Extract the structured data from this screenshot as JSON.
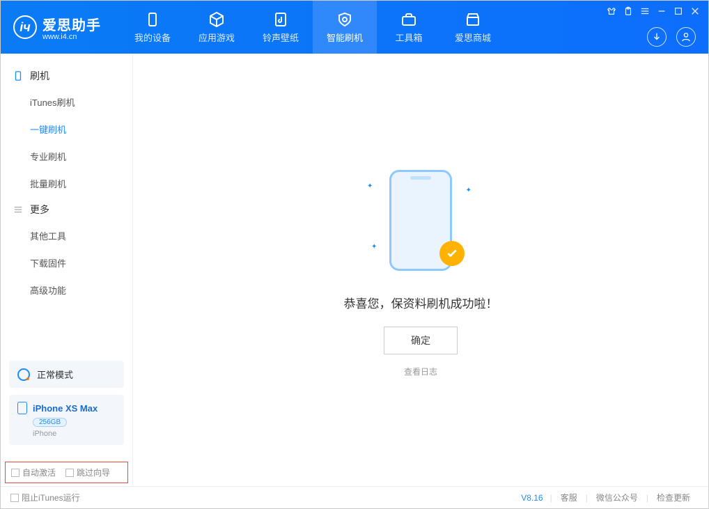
{
  "app": {
    "name": "爱思助手",
    "domain": "www.i4.cn"
  },
  "nav": {
    "items": [
      {
        "label": "我的设备"
      },
      {
        "label": "应用游戏"
      },
      {
        "label": "铃声壁纸"
      },
      {
        "label": "智能刷机"
      },
      {
        "label": "工具箱"
      },
      {
        "label": "爱思商城"
      }
    ]
  },
  "sidebar": {
    "section1": {
      "title": "刷机"
    },
    "items1": [
      {
        "label": "iTunes刷机"
      },
      {
        "label": "一键刷机"
      },
      {
        "label": "专业刷机"
      },
      {
        "label": "批量刷机"
      }
    ],
    "section2": {
      "title": "更多"
    },
    "items2": [
      {
        "label": "其他工具"
      },
      {
        "label": "下载固件"
      },
      {
        "label": "高级功能"
      }
    ]
  },
  "mode": {
    "label": "正常模式"
  },
  "device": {
    "name": "iPhone XS Max",
    "capacity": "256GB",
    "type": "iPhone"
  },
  "options": {
    "auto_activate": "自动激活",
    "skip_guide": "跳过向导"
  },
  "main": {
    "success_text": "恭喜您，保资料刷机成功啦！",
    "ok_label": "确定",
    "view_log": "查看日志"
  },
  "footer": {
    "block_itunes": "阻止iTunes运行",
    "version": "V8.16",
    "links": [
      "客服",
      "微信公众号",
      "检查更新"
    ]
  }
}
